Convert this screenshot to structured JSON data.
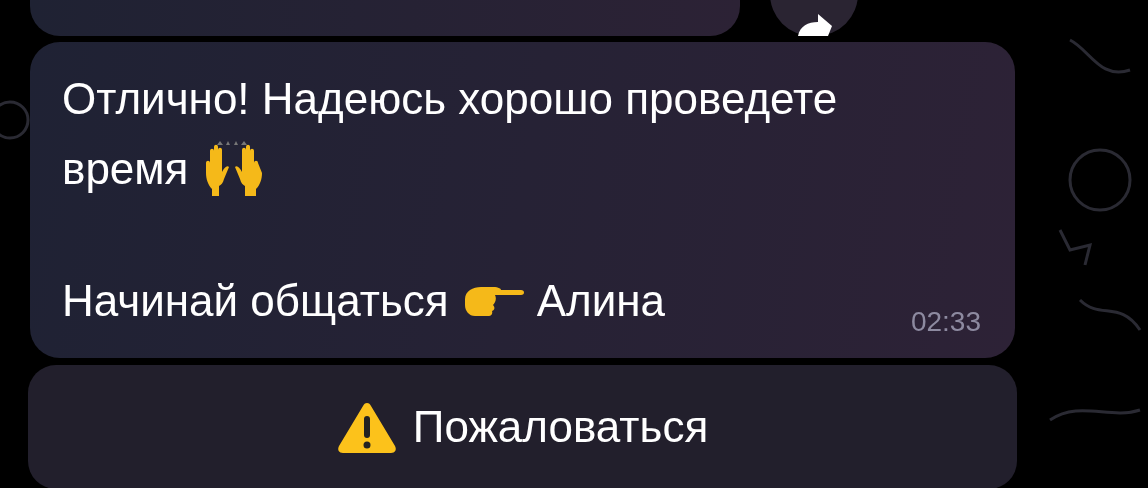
{
  "message": {
    "paragraphs": [
      {
        "lines": [
          [
            {
              "kind": "text",
              "text": "Отлично! Надеюсь хорошо проведете"
            }
          ],
          [
            {
              "kind": "text",
              "text": "время"
            },
            {
              "kind": "raised-hands"
            }
          ]
        ]
      },
      {
        "lines": [
          [
            {
              "kind": "text",
              "text": "Начинай общаться"
            },
            {
              "kind": "pointing-hand"
            },
            {
              "kind": "text",
              "text": "Алина"
            }
          ]
        ]
      }
    ],
    "time": "02:33"
  },
  "report_button": {
    "label": "Пожаловаться"
  }
}
